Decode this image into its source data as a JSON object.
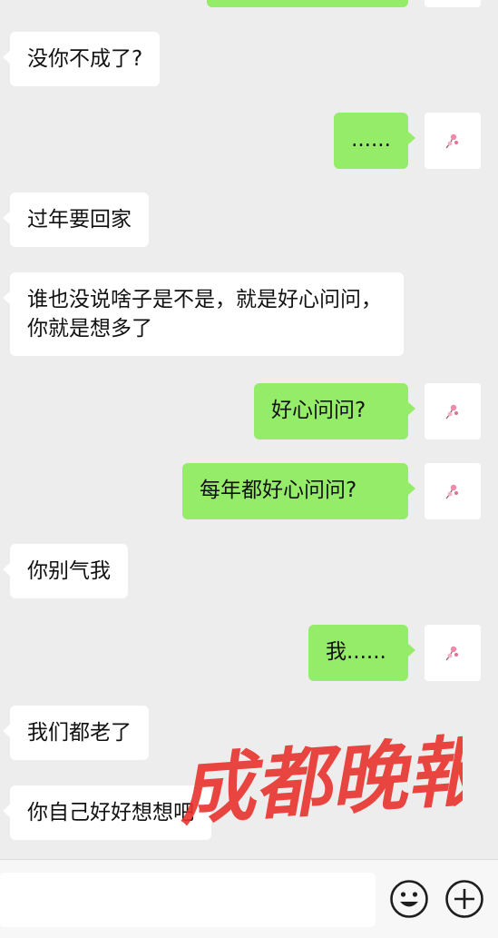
{
  "messages": [
    {
      "side": "in",
      "text": "没你不成了?"
    },
    {
      "side": "out",
      "text": "......"
    },
    {
      "side": "in",
      "text": "过年要回家"
    },
    {
      "side": "in",
      "text": "谁也没说啥子是不是，就是好心问问，你就是想多了"
    },
    {
      "side": "out",
      "text": "好心问问?"
    },
    {
      "side": "out",
      "text": "每年都好心问问?"
    },
    {
      "side": "in",
      "text": "你别气我"
    },
    {
      "side": "out",
      "text": "我......"
    },
    {
      "side": "in",
      "text": "我们都老了"
    },
    {
      "side": "in",
      "text": "你自己好好想想吧"
    }
  ],
  "watermark": {
    "text": "成都晚報"
  },
  "input_bar": {
    "emoji_icon": "smiley-face-icon",
    "plus_icon": "plus-circle-icon"
  },
  "colors": {
    "incoming": "#ffffff",
    "outgoing": "#95ec69",
    "background": "#ededed",
    "watermark": "#e8322e"
  }
}
